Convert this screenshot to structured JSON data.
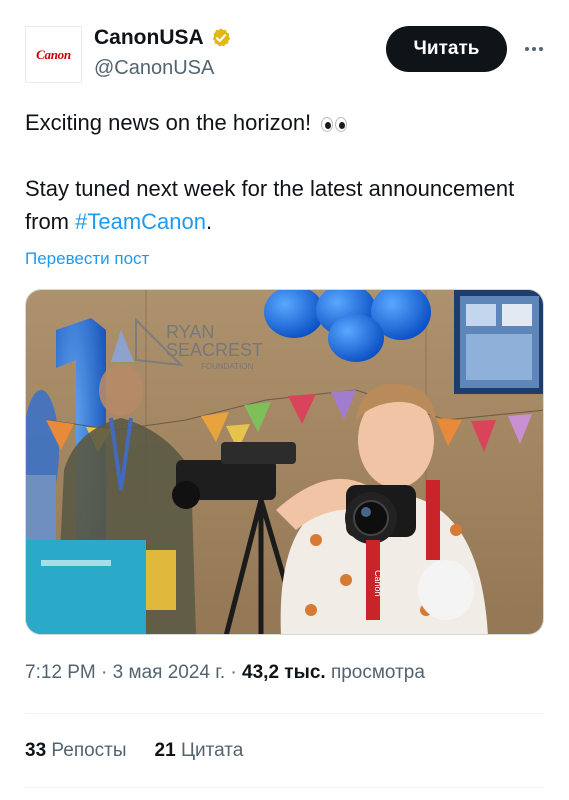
{
  "author": {
    "avatar_text": "Canon",
    "name": "CanonUSA",
    "handle": "@CanonUSA",
    "verified_color": "#e2b719"
  },
  "actions": {
    "follow_label": "Читать",
    "more_icon": "more-horizontal-icon"
  },
  "tweet": {
    "line1": "Exciting news on the horizon!",
    "line1_emoji": "eyes-emoji",
    "line2_prefix": "Stay tuned next week for the latest announcement from ",
    "hashtag": "#TeamCanon",
    "line2_suffix": ".",
    "translate": "Перевести пост"
  },
  "media": {
    "sign_line1": "RYAN",
    "sign_line2": "SEACREST",
    "sign_line3": "FOUNDATION",
    "camera_brand": "Canon"
  },
  "meta": {
    "time": "7:12 PM",
    "sep1": " · ",
    "date": "3 мая 2024 г.",
    "sep2": " · ",
    "views_count": "43,2 тыс.",
    "views_label": " просмотра"
  },
  "stats": {
    "reposts_count": "33",
    "reposts_label": "Репосты",
    "quotes_count": "21",
    "quotes_label": "Цитата"
  },
  "colors": {
    "accent": "#1d9bf0",
    "text": "#0f1419",
    "muted": "#536471"
  }
}
